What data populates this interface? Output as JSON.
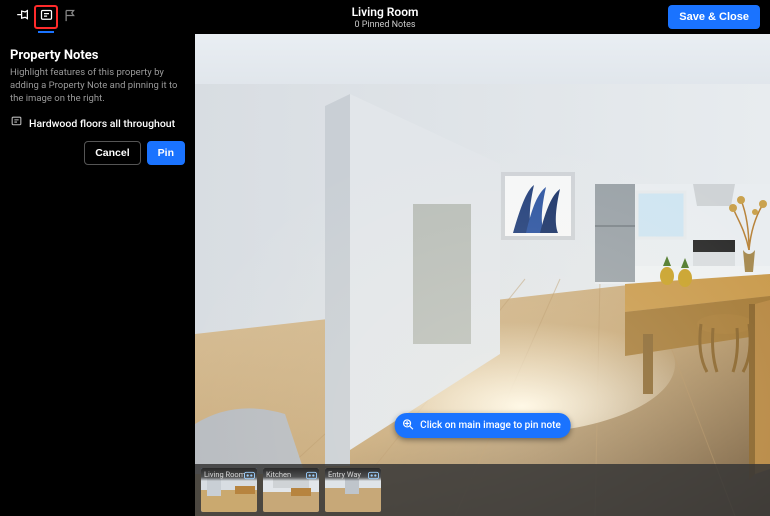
{
  "header": {
    "room_name": "Living Room",
    "pinned_sub": "0 Pinned Notes",
    "save_label": "Save & Close"
  },
  "tools": {
    "pin_icon": "pin-icon",
    "note_icon": "note-icon",
    "flag_icon": "flag-icon"
  },
  "sidebar": {
    "title": "Property Notes",
    "desc": "Highlight features of this property by adding a Property Note and pinning it to the image on the right.",
    "note_text": "Hardwood floors all throughout",
    "cancel_label": "Cancel",
    "pin_label": "Pin"
  },
  "viewer": {
    "hint": "Click on main image to pin note"
  },
  "thumbs": [
    {
      "label": "Living Room",
      "selected": true
    },
    {
      "label": "Kitchen",
      "selected": false
    },
    {
      "label": "Entry Way",
      "selected": false
    }
  ],
  "colors": {
    "accent": "#1a73ff",
    "highlight": "#ff2b2b"
  }
}
